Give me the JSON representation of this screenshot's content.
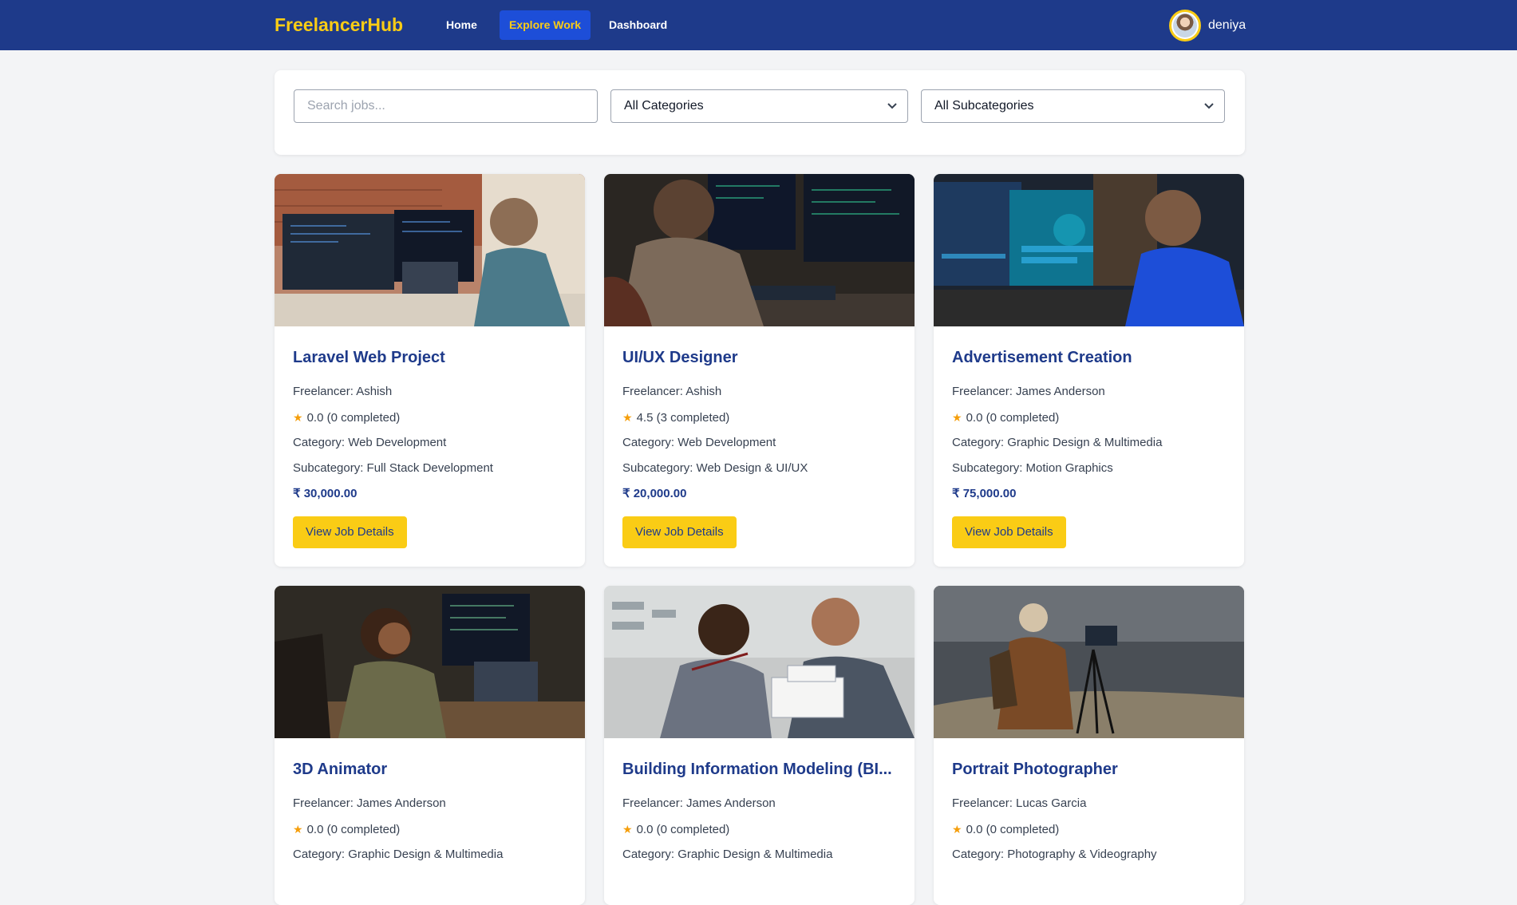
{
  "nav": {
    "brand": "FreelancerHub",
    "links": [
      {
        "label": "Home"
      },
      {
        "label": "Explore Work"
      },
      {
        "label": "Dashboard"
      }
    ],
    "user": {
      "name": "deniya"
    }
  },
  "filters": {
    "search_placeholder": "Search jobs...",
    "category_value": "All Categories",
    "subcategory_value": "All Subcategories"
  },
  "jobs": [
    {
      "title": "Laravel Web Project",
      "freelancer": "Freelancer: Ashish",
      "rating": "0.0 (0 completed)",
      "category": "Category: Web Development",
      "subcategory": "Subcategory: Full Stack Development",
      "price": "₹ 30,000.00",
      "button": "View Job Details"
    },
    {
      "title": "UI/UX Designer",
      "freelancer": "Freelancer: Ashish",
      "rating": "4.5 (3 completed)",
      "category": "Category: Web Development",
      "subcategory": "Subcategory: Web Design & UI/UX",
      "price": "₹ 20,000.00",
      "button": "View Job Details"
    },
    {
      "title": "Advertisement Creation",
      "freelancer": "Freelancer: James Anderson",
      "rating": "0.0 (0 completed)",
      "category": "Category: Graphic Design & Multimedia",
      "subcategory": "Subcategory: Motion Graphics",
      "price": "₹ 75,000.00",
      "button": "View Job Details"
    },
    {
      "title": "3D Animator",
      "freelancer": "Freelancer: James Anderson",
      "rating": "0.0 (0 completed)",
      "category": "Category: Graphic Design & Multimedia"
    },
    {
      "title": "Building Information Modeling (BI...",
      "freelancer": "Freelancer: James Anderson",
      "rating": "0.0 (0 completed)",
      "category": "Category: Graphic Design & Multimedia"
    },
    {
      "title": "Portrait Photographer",
      "freelancer": "Freelancer: Lucas Garcia",
      "rating": "0.0 (0 completed)",
      "category": "Category: Photography & Videography"
    }
  ],
  "icons": {
    "rating": "star-icon",
    "dropdown": "chevron-down-icon"
  },
  "colors": {
    "navbar": "#1e3a8a",
    "brand": "#facc15",
    "accent_button": "#facc15",
    "title": "#1e3a8a",
    "star": "#f59e0b"
  }
}
